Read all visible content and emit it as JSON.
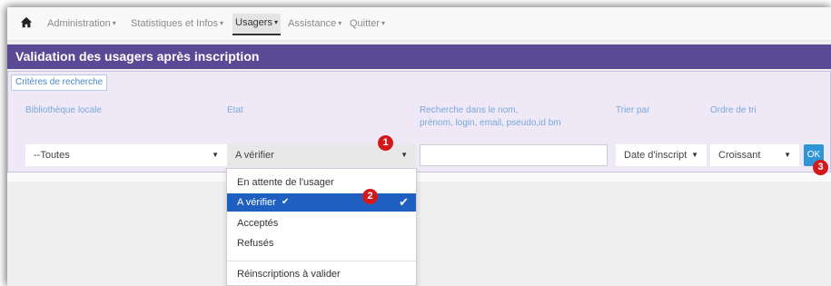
{
  "nav": {
    "items": [
      {
        "label": "Administration",
        "caret": "▾"
      },
      {
        "label": "Statistiques et Infos",
        "caret": "▾"
      },
      {
        "label": "Usagers",
        "caret": "▾"
      },
      {
        "label": "Assistance",
        "caret": "▾"
      },
      {
        "label": "Quitter",
        "caret": "▾"
      }
    ],
    "home_icon": "home-icon"
  },
  "page": {
    "title": "Validation des usagers après inscription"
  },
  "search": {
    "tab_label": "Critères de recherche",
    "bibliotheque": {
      "label": "Bibliothèque locale",
      "value": "--Toutes"
    },
    "etat": {
      "label": "Etat",
      "value": "A vérifier"
    },
    "recherche": {
      "label_line1": "Recherche dans le nom,",
      "label_line2": "prénom, login, email, pseudo,id bm",
      "value": ""
    },
    "trier": {
      "label": "Trier par",
      "value": "Date d'inscript"
    },
    "ordre": {
      "label": "Ordre de tri",
      "value": "Croissant"
    },
    "ok_label": "OK"
  },
  "etat_menu": {
    "options": [
      {
        "label": "En attente de l'usager"
      },
      {
        "label": "A vérifier",
        "check": "✔"
      },
      {
        "label": "Acceptés"
      },
      {
        "label": "Refusés"
      },
      {
        "label": "Réinscriptions à valider"
      }
    ]
  },
  "badges": [
    "1",
    "2",
    "3"
  ],
  "colors": {
    "titlebar": "#5a4a96",
    "panel": "#efe9f7",
    "selected": "#1f5fbf",
    "ok": "#2f95d6",
    "badge": "#d31a1a"
  }
}
